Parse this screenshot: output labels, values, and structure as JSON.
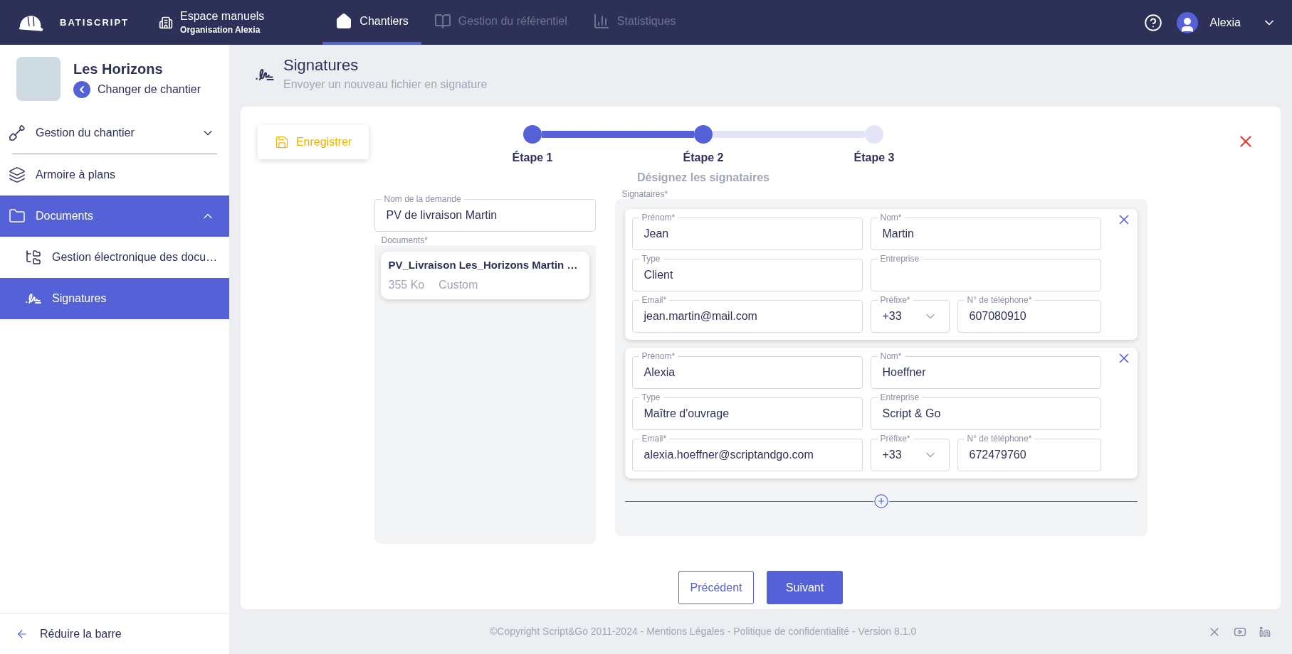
{
  "topbar": {
    "brand": "BATISCRIPT",
    "space": {
      "title": "Espace manuels",
      "subtitle": "Organisation Alexia"
    },
    "nav": [
      {
        "label": "Chantiers",
        "selected": true
      },
      {
        "label": "Gestion du référentiel",
        "selected": false
      },
      {
        "label": "Statistiques",
        "selected": false
      }
    ],
    "user": "Alexia"
  },
  "sidebar": {
    "project": "Les Horizons",
    "change": "Changer de chantier",
    "items": [
      {
        "label": "Gestion du chantier",
        "selected": false,
        "expanded": false
      },
      {
        "label": "Armoire à plans",
        "selected": false
      },
      {
        "label": "Documents",
        "selected": true,
        "expanded": true,
        "children": [
          {
            "label": "Gestion électronique des docu…",
            "selected": false
          },
          {
            "label": "Signatures",
            "selected": true
          }
        ]
      }
    ],
    "collapse": "Réduire la barre"
  },
  "page": {
    "title": "Signatures",
    "subtitle": "Envoyer un nouveau fichier en signature"
  },
  "save_button": "Enregistrer",
  "stepper": {
    "steps": [
      {
        "label": "Étape 1",
        "reached": true
      },
      {
        "label": "Étape 2",
        "reached": true
      },
      {
        "label": "Étape 3",
        "reached": false
      }
    ],
    "caption": "Désignez les signataires"
  },
  "request": {
    "label": "Nom de la demande",
    "value": "PV de livraison Martin"
  },
  "documents": {
    "label": "Documents*",
    "items": [
      {
        "name": "PV_Livraison Les_Horizons Martin …",
        "size": "355 Ko",
        "type": "Custom"
      }
    ]
  },
  "signers": {
    "label": "Signataires*",
    "items": [
      {
        "fields": [
          {
            "kind": "text",
            "label": "Prénom*",
            "value": "Jean"
          },
          {
            "kind": "text",
            "label": "Nom*",
            "value": "Martin"
          },
          {
            "kind": "text",
            "label": "Type",
            "value": "Client"
          },
          {
            "kind": "text",
            "label": "Entreprise"
          },
          {
            "kind": "text",
            "label": "Email*",
            "value": "jean.martin@mail.com"
          },
          {
            "kind": "select",
            "label": "Préfixe*",
            "value": "+33"
          },
          {
            "kind": "text",
            "label": "N° de téléphone*",
            "value": "607080910"
          }
        ]
      },
      {
        "fields": [
          {
            "kind": "text",
            "label": "Prénom*",
            "value": "Alexia"
          },
          {
            "kind": "text",
            "label": "Nom*",
            "value": "Hoeffner"
          },
          {
            "kind": "text",
            "label": "Type",
            "value": "Maître d'ouvrage"
          },
          {
            "kind": "text",
            "label": "Entreprise",
            "value": "Script & Go"
          },
          {
            "kind": "text",
            "label": "Email*",
            "value": "alexia.hoeffner@scriptandgo.com"
          },
          {
            "kind": "select",
            "label": "Préfixe*",
            "value": "+33"
          },
          {
            "kind": "text",
            "label": "N° de téléphone*",
            "value": "672479760"
          }
        ]
      }
    ]
  },
  "buttons": {
    "previous": "Précédent",
    "next": "Suivant"
  },
  "footer": "©Copyright Script&Go 2011-2024 - Mentions Légales - Politique de confidentialité - Version 8.1.0"
}
